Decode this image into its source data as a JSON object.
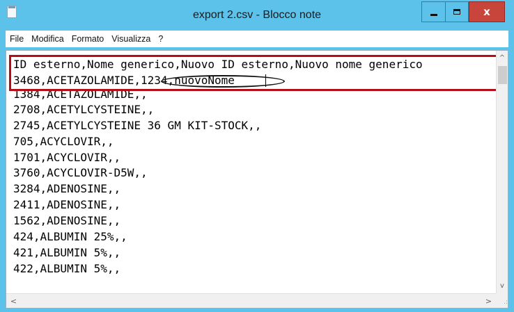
{
  "window": {
    "title": "export 2.csv - Blocco note",
    "minimize_glyph": "",
    "close_glyph": "x"
  },
  "menu": {
    "items": [
      "File",
      "Modifica",
      "Formato",
      "Visualizza",
      "?"
    ]
  },
  "document": {
    "lines": [
      "ID esterno,Nome generico,Nuovo ID esterno,Nuovo nome generico",
      "3468,ACETAZOLAMIDE,1234,nuovoNome",
      "1384,ACETAZOLAMIDE,,",
      "2708,ACETYLCYSTEINE,,",
      "2745,ACETYLCYSTEINE 36 GM KIT-STOCK,,",
      "705,ACYCLOVIR,,",
      "1701,ACYCLOVIR,,",
      "3760,ACYCLOVIR-D5W,,",
      "3284,ADENOSINE,,",
      "2411,ADENOSINE,,",
      "1562,ADENOSINE,,",
      "424,ALBUMIN 25%,,",
      "421,ALBUMIN 5%,,",
      "422,ALBUMIN 5%,,"
    ]
  },
  "scrollbars": {
    "up_arrow": "^",
    "down_arrow": "v",
    "left_arrow": "<",
    "right_arrow": ">",
    "grip": ".:"
  },
  "colors": {
    "titlebar": "#5cc2ea",
    "close_button": "#c7453a",
    "annotation_rect": "#b40d16",
    "annotation_ellipse": "#111111"
  }
}
